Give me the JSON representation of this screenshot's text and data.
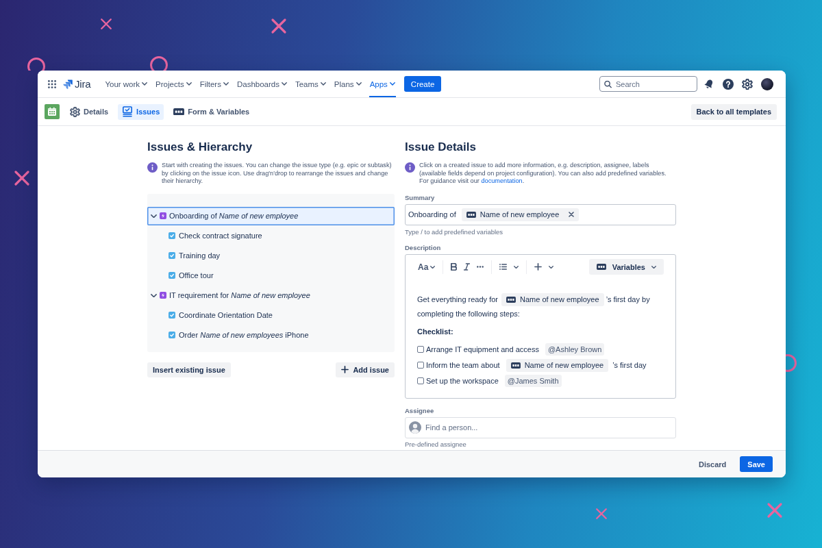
{
  "topnav": {
    "logo": "Jira",
    "items": [
      {
        "label": "Your work",
        "selected": false
      },
      {
        "label": "Projects",
        "selected": false
      },
      {
        "label": "Filters",
        "selected": false
      },
      {
        "label": "Dashboards",
        "selected": false
      },
      {
        "label": "Teams",
        "selected": false
      },
      {
        "label": "Plans",
        "selected": false
      },
      {
        "label": "Apps",
        "selected": true
      }
    ],
    "create_button": "Create",
    "search": {
      "placeholder": "Search"
    }
  },
  "subnav": {
    "tabs": [
      {
        "label": "Details",
        "selected": false
      },
      {
        "label": "Issues",
        "selected": true
      },
      {
        "label": "Form & Variables",
        "selected": false
      }
    ],
    "back_button": "Back to all templates"
  },
  "issues_panel": {
    "title": "Issues & Hierarchy",
    "info": "Start with creating the issues. You can change the issue type (e.g. epic or subtask) by clicking on the issue icon. Use drag'n'drop to rearrange the issues and change their hierarchy.",
    "tree": [
      {
        "kind": "epic",
        "title": "Onboarding of *Name of new employee*",
        "expanded": true,
        "selected": true,
        "children": [
          {
            "kind": "task",
            "title": "Check contract signature",
            "selected": false
          },
          {
            "kind": "task",
            "title": "Training day",
            "selected": false
          },
          {
            "kind": "task",
            "title": "Office tour",
            "selected": false
          }
        ]
      },
      {
        "kind": "epic",
        "title": "IT requirement for *Name of new employee*",
        "expanded": true,
        "selected": false,
        "children": [
          {
            "kind": "task",
            "title": "Coordinate Orientation Date",
            "selected": false
          },
          {
            "kind": "task",
            "title": "Order *Name of new employees* iPhone",
            "selected": false
          }
        ]
      }
    ],
    "insert_button": "Insert existing issue",
    "add_button": "Add issue"
  },
  "details_panel": {
    "title": "Issue Details",
    "info": {
      "text": "Click on a created issue to add more information, e.g. description, assignee, labels (available fields depend on project configuration). You can also add predefined variables. For guidance visit our",
      "link": "documentation",
      "end": "."
    },
    "summary": {
      "label": "Summary",
      "text": "Onboarding of",
      "variable": "Name of new employee",
      "hint": "Type / to add predefined variables"
    },
    "description": {
      "label": "Description",
      "toolbar": {
        "text_style": "Aa",
        "variables_button": "Variables"
      },
      "intro": {
        "before": "Get everything ready for",
        "variable": "Name of new employee",
        "after": "’s first day by completing the following steps:"
      },
      "checklist_title": "Checklist:",
      "checklist": [
        {
          "kind": "mention",
          "checked": false,
          "text": "Arrange IT equipment and access",
          "mention": "@Ashley Brown"
        },
        {
          "kind": "variable",
          "checked": false,
          "text": "Inform the team about",
          "variable": "Name of new employee",
          "after": "’s first day"
        },
        {
          "kind": "mention",
          "checked": false,
          "text": "Set up the workspace",
          "mention": "@James Smith"
        }
      ]
    },
    "assignee": {
      "label": "Assignee",
      "placeholder": "Find a person...",
      "hint": "Pre-defined assignee"
    }
  },
  "footer": {
    "discard_button": "Discard",
    "save_button": "Save"
  }
}
